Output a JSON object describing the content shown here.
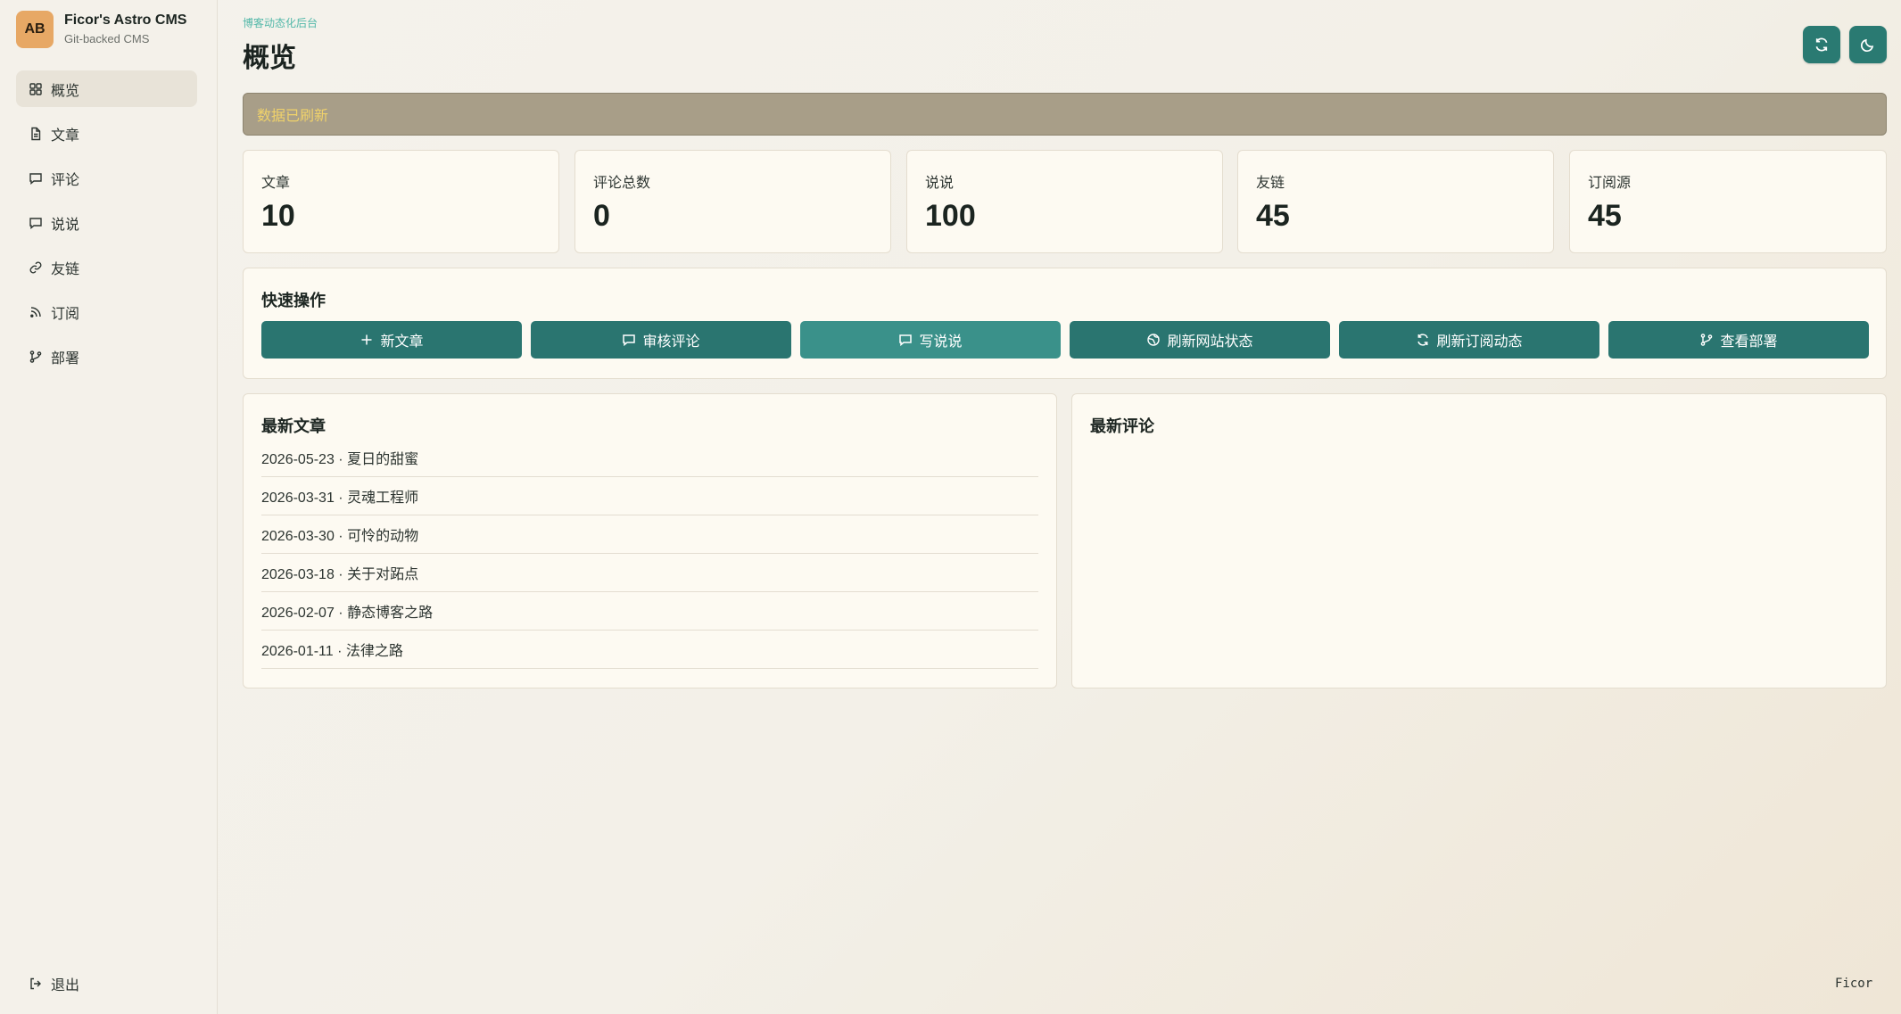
{
  "brand": {
    "avatar": "AB",
    "title": "Ficor's Astro CMS",
    "subtitle": "Git-backed CMS"
  },
  "sidebar": {
    "items": [
      {
        "label": "概览",
        "icon": "dashboard-icon",
        "active": true
      },
      {
        "label": "文章",
        "icon": "document-icon"
      },
      {
        "label": "评论",
        "icon": "comment-icon"
      },
      {
        "label": "说说",
        "icon": "comment-icon"
      },
      {
        "label": "友链",
        "icon": "link-icon"
      },
      {
        "label": "订阅",
        "icon": "rss-icon"
      },
      {
        "label": "部署",
        "icon": "git-branch-icon"
      }
    ],
    "logout": "退出"
  },
  "header": {
    "eyebrow": "博客动态化后台",
    "title": "概览"
  },
  "toast": "数据已刷新",
  "stats": [
    {
      "label": "文章",
      "value": "10"
    },
    {
      "label": "评论总数",
      "value": "0"
    },
    {
      "label": "说说",
      "value": "100"
    },
    {
      "label": "友链",
      "value": "45"
    },
    {
      "label": "订阅源",
      "value": "45"
    }
  ],
  "quick_actions": {
    "title": "快速操作",
    "buttons": [
      {
        "label": "新文章",
        "icon": "plus-icon"
      },
      {
        "label": "审核评论",
        "icon": "comment-icon"
      },
      {
        "label": "写说说",
        "icon": "comment-icon"
      },
      {
        "label": "刷新网站状态",
        "icon": "globe-icon"
      },
      {
        "label": "刷新订阅动态",
        "icon": "refresh-icon"
      },
      {
        "label": "查看部署",
        "icon": "git-branch-icon"
      }
    ]
  },
  "latest_posts": {
    "title": "最新文章",
    "items": [
      "2026-05-23 · 夏日的甜蜜",
      "2026-03-31 · 灵魂工程师",
      "2026-03-30 · 可怜的动物",
      "2026-03-18 · 关于对跖点",
      "2026-02-07 · 静态博客之路",
      "2026-01-11 · 法律之路"
    ]
  },
  "latest_comments": {
    "title": "最新评论"
  },
  "footer_mark": "Ficor",
  "colors": {
    "accent": "#2a7570",
    "toast_bg": "#a89e88",
    "toast_text": "#f0d26a",
    "avatar": "#e7a865"
  }
}
